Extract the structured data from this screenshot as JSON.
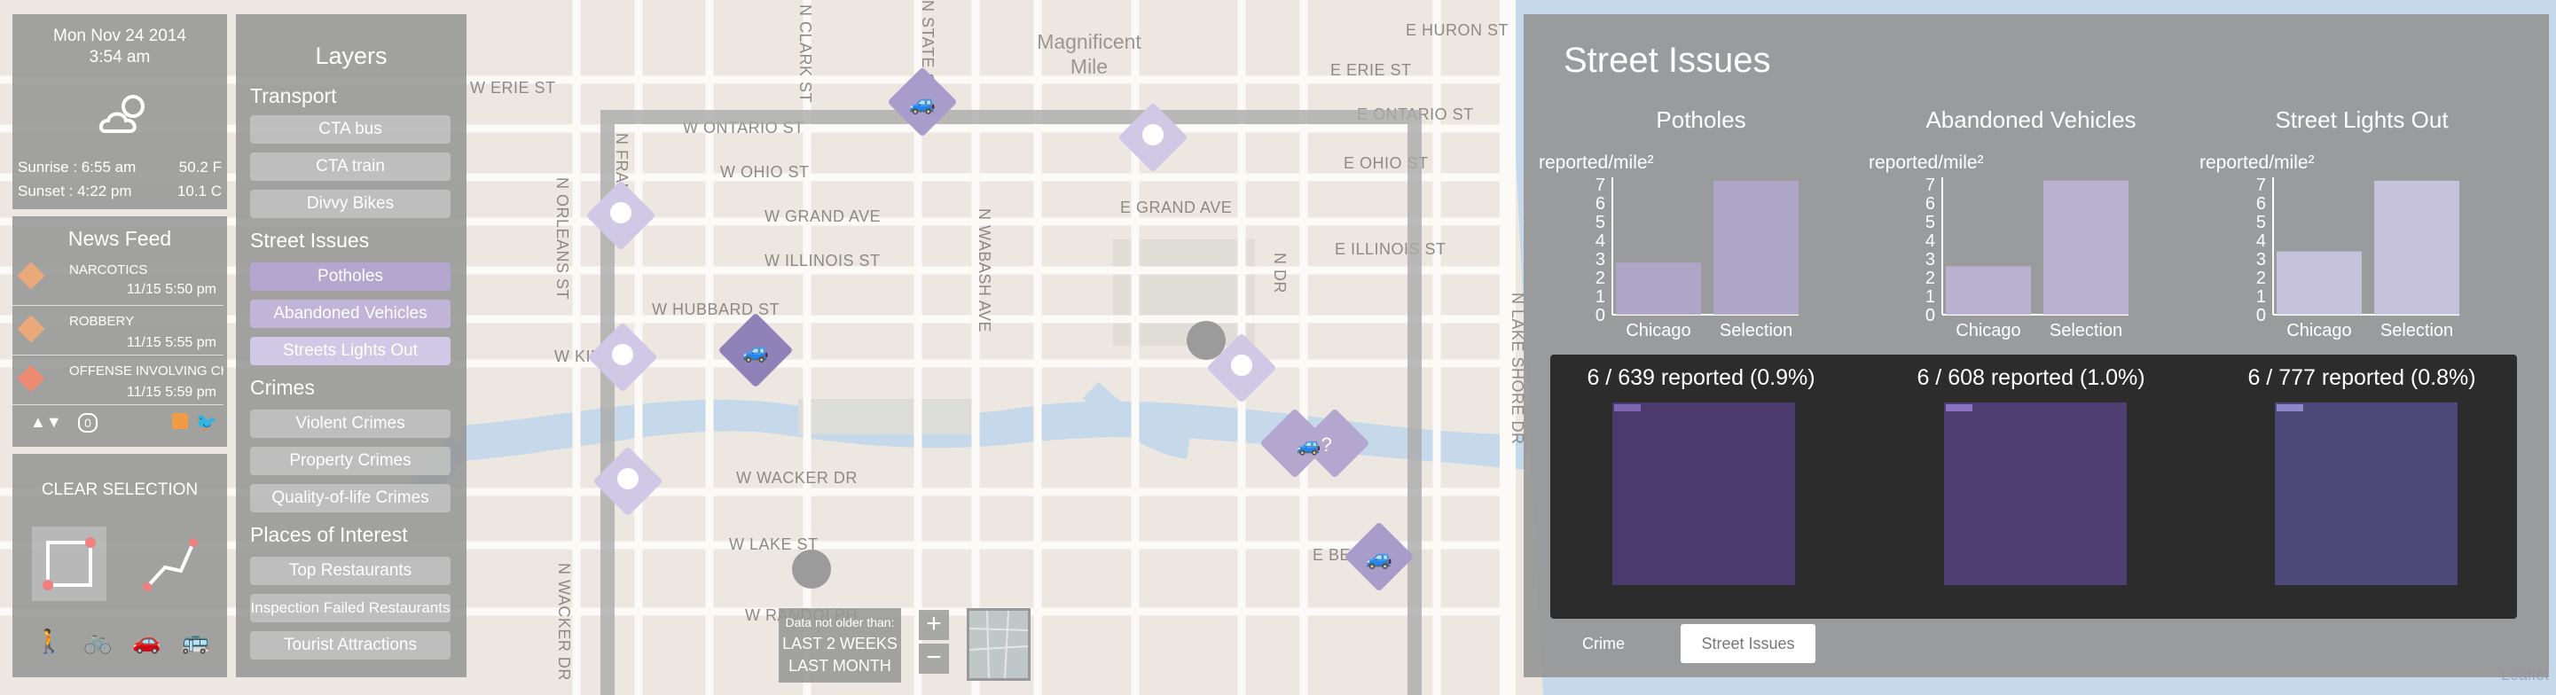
{
  "map": {
    "areas": [
      "Magnificent",
      "Mile"
    ],
    "streets": [
      "E HURON ST",
      "E ERIE ST",
      "E ONTARIO ST",
      "E OHIO ST",
      "E GRAND AVE",
      "E ILLINOIS ST",
      "W ONTARIO ST",
      "W OHIO ST",
      "W GRAND AVE",
      "W ILLINOIS ST",
      "W HUBBARD ST",
      "W KINZIE",
      "W ERIE ST",
      "W WACKER DR",
      "W LAKE ST",
      "W RANDOLPH",
      "N CLARK ST",
      "N STATE ST",
      "N WABASH AVE",
      "N ORLEANS ST",
      "N FRANKLIN",
      "N WACKER DR",
      "N LAKE SHORE DR",
      "N DR",
      "E BE"
    ],
    "attribution": "Leaflet"
  },
  "clock": {
    "date": "Mon Nov 24 2014",
    "time": "3:54 am",
    "sunrise": "Sunrise : 6:55 am",
    "sunset": "Sunset : 4:22 pm",
    "temp_f": "50.2 F",
    "temp_c": "10.1 C",
    "weather_icon": "cloudy-night-icon"
  },
  "news": {
    "title": "News Feed",
    "items": [
      {
        "title": "NARCOTICS",
        "time": "11/15 5:50 pm",
        "icon": "narcotics-icon"
      },
      {
        "title": "ROBBERY",
        "time": "11/15 5:55 pm",
        "icon": "robbery-icon"
      },
      {
        "title": "OFFENSE INVOLVING CH",
        "time": "11/15 5:59 pm",
        "icon": "offense-icon"
      }
    ],
    "counter": "0"
  },
  "selection": {
    "clear_label": "CLEAR SELECTION",
    "modes": [
      "walk-icon",
      "bike-icon",
      "car-icon",
      "bus-icon"
    ]
  },
  "layers": {
    "title": "Layers",
    "sections": [
      {
        "name": "Transport",
        "items": [
          "CTA bus",
          "CTA train",
          "Divvy Bikes"
        ]
      },
      {
        "name": "Street Issues",
        "items": [
          "Potholes",
          "Abandoned Vehicles",
          "Streets Lights Out"
        ]
      },
      {
        "name": "Crimes",
        "items": [
          "Violent Crimes",
          "Property Crimes",
          "Quality-of-life Crimes"
        ]
      },
      {
        "name": "Places of Interest",
        "items": [
          "Top Restaurants",
          "Inspection Failed Restaurants",
          "Tourist Attractions"
        ]
      }
    ]
  },
  "time_filter": {
    "label": "Data not older than:",
    "options": [
      "LAST 2 WEEKS",
      "LAST MONTH"
    ]
  },
  "zoom": {
    "in": "+",
    "out": "−"
  },
  "street_issues": {
    "title": "Street Issues",
    "tabs": [
      "Crime",
      "Street Issues"
    ],
    "active_tab": "Street Issues",
    "colors": {
      "potholes": "#b3a7cf",
      "vehicles": "#c0b5d9",
      "lights": "#cfc9e6"
    }
  },
  "chart_data": [
    {
      "type": "bar",
      "title": "Potholes",
      "ylabel": "reported/mile²",
      "categories": [
        "Chicago",
        "Selection"
      ],
      "values": [
        2.8,
        7.2
      ],
      "ylim": [
        0,
        7
      ],
      "yticks": [
        0,
        1,
        2,
        3,
        4,
        5,
        6,
        7
      ],
      "caption": "6 / 639 reported (0.9%)",
      "share": 0.009
    },
    {
      "type": "bar",
      "title": "Abandoned Vehicles",
      "ylabel": "reported/mile²",
      "categories": [
        "Chicago",
        "Selection"
      ],
      "values": [
        2.6,
        7.2
      ],
      "ylim": [
        0,
        7
      ],
      "yticks": [
        0,
        1,
        2,
        3,
        4,
        5,
        6,
        7
      ],
      "caption": "6 / 608 reported (1.0%)",
      "share": 0.01
    },
    {
      "type": "bar",
      "title": "Street Lights Out",
      "ylabel": "reported/mile²",
      "categories": [
        "Chicago",
        "Selection"
      ],
      "values": [
        3.4,
        7.2
      ],
      "ylim": [
        0,
        7
      ],
      "yticks": [
        0,
        1,
        2,
        3,
        4,
        5,
        6,
        7
      ],
      "caption": "6 / 777 reported (0.8%)",
      "share": 0.008
    }
  ]
}
